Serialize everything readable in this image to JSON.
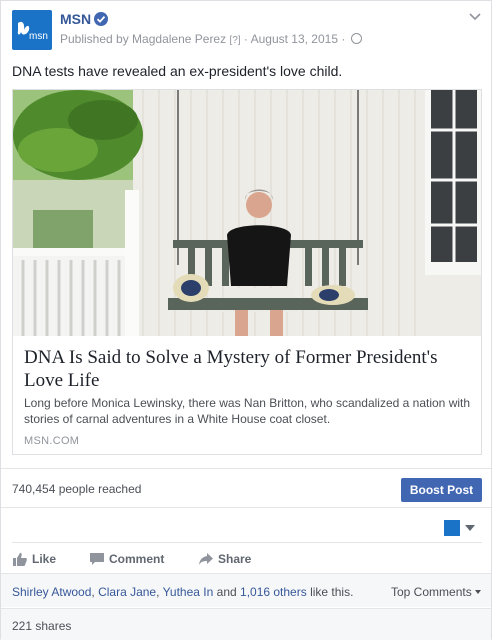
{
  "post": {
    "page_name": "MSN",
    "avatar_text": "msn",
    "published_by": "Published by Magdalene Perez",
    "help_mark": "[?]",
    "date": "August 13, 2015",
    "caption": "DNA tests have revealed an ex-president's love child."
  },
  "link_preview": {
    "title": "DNA Is Said to Solve a Mystery of Former President's Love Life",
    "description": "Long before Monica Lewinsky, there was Nan Britton, who scandalized a nation with stories of carnal adventures in a White House coat closet.",
    "domain": "MSN.COM"
  },
  "insights": {
    "reach": "740,454 people reached",
    "boost_label": "Boost Post"
  },
  "actions": {
    "like": "Like",
    "comment": "Comment",
    "share": "Share"
  },
  "social": {
    "likers": [
      "Shirley Atwood",
      "Clara Jane",
      "Yuthea In"
    ],
    "and": "and",
    "others": "1,016 others",
    "suffix": "like this.",
    "sep": ",",
    "top_comments": "Top Comments",
    "shares": "221 shares"
  },
  "colors": {
    "brand": "#4267b2",
    "link": "#365899",
    "msn_blue": "#1a73c7"
  },
  "icons": {
    "verified": "verified-badge-icon",
    "globe": "globe-icon",
    "chevron": "chevron-down-icon",
    "like": "thumbs-up-icon",
    "comment": "speech-bubble-icon",
    "share": "share-arrow-icon"
  }
}
